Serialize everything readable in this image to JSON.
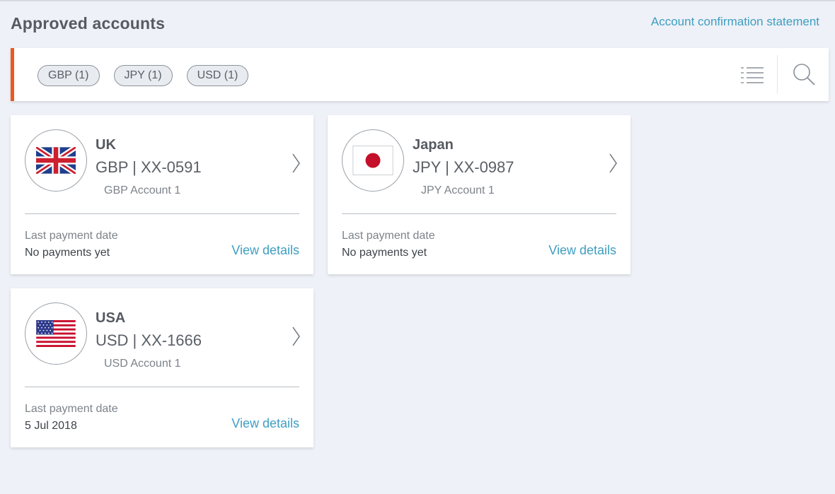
{
  "header": {
    "title": "Approved accounts",
    "statement_link": "Account confirmation statement"
  },
  "filters": {
    "chips": [
      "GBP (1)",
      "JPY (1)",
      "USD (1)"
    ]
  },
  "icons": {
    "list_view": "list-icon",
    "search": "search-icon"
  },
  "colors": {
    "accent": "#ea5a1e",
    "link": "#3f9ec2"
  },
  "accounts": [
    {
      "country": "UK",
      "account_no": "GBP | XX-0591",
      "account_name": "GBP Account 1",
      "last_payment_label": "Last payment date",
      "last_payment_value": "No payments yet",
      "view_details": "View details",
      "flag": "uk-flag-icon"
    },
    {
      "country": "Japan",
      "account_no": "JPY | XX-0987",
      "account_name": "JPY Account 1",
      "last_payment_label": "Last payment date",
      "last_payment_value": "No payments yet",
      "view_details": "View details",
      "flag": "japan-flag-icon"
    },
    {
      "country": "USA",
      "account_no": "USD | XX-1666",
      "account_name": "USD Account 1",
      "last_payment_label": "Last payment date",
      "last_payment_value": "5 Jul 2018",
      "view_details": "View details",
      "flag": "usa-flag-icon"
    }
  ]
}
